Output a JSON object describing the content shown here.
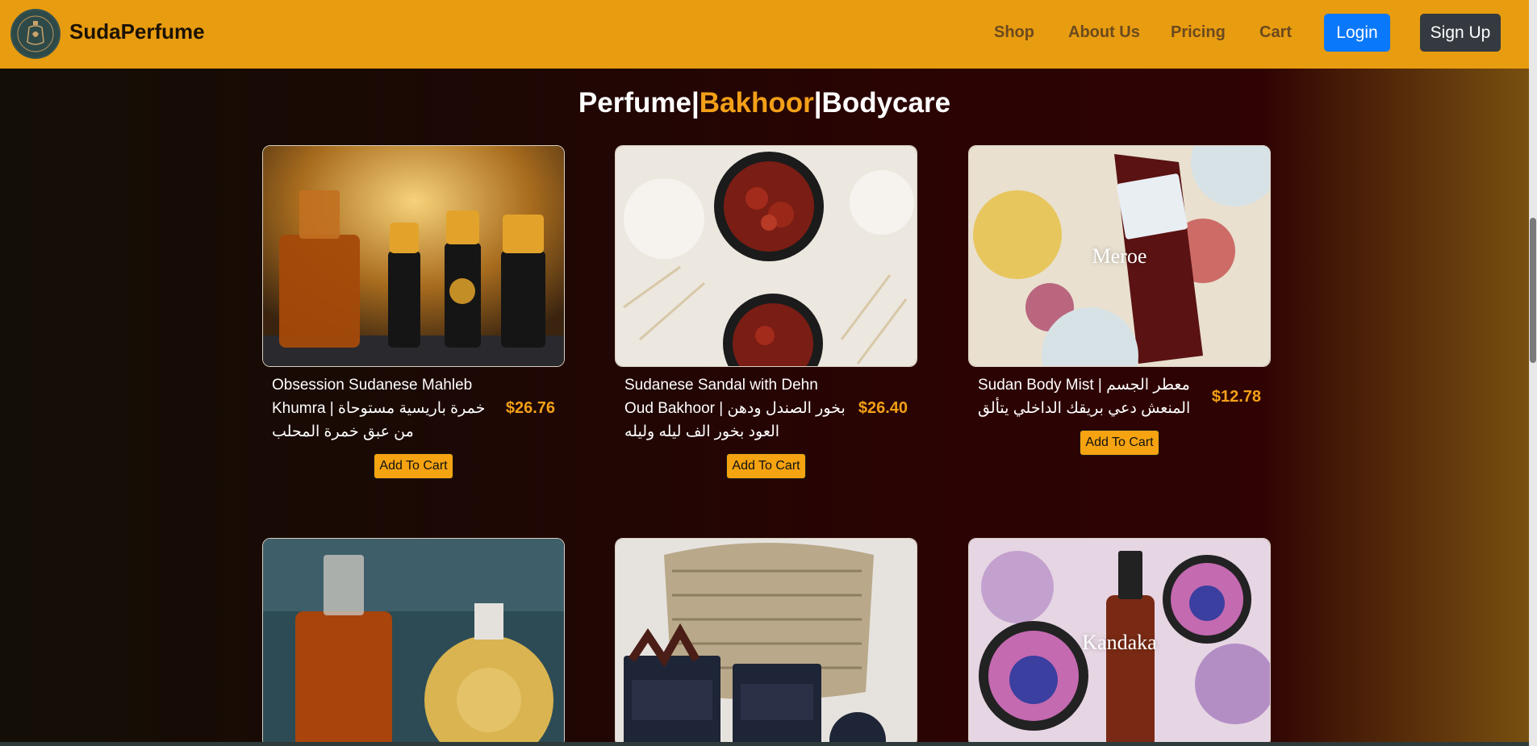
{
  "brand": {
    "name": "SudaPerfume",
    "logo_icon": "perfume-logo-icon"
  },
  "nav": {
    "links": [
      {
        "label": "Shop"
      },
      {
        "label": "About Us"
      },
      {
        "label": "Pricing"
      },
      {
        "label": "Cart"
      }
    ],
    "login_label": "Login",
    "signup_label": "Sign Up"
  },
  "section_title": {
    "part1": "Perfume",
    "sep1": "|",
    "part2": "Bakhoor",
    "sep2": "|",
    "part3": "Bodycare"
  },
  "colors": {
    "navbar": "#e89c10",
    "accent": "#f3a018",
    "login": "#0a78fa",
    "signup": "#343a40"
  },
  "products": [
    {
      "name": "Obsession Sudanese Mahleb Khumra | خمرة باريسية مستوحاة من عبق خمرة المحلب",
      "price": "$26.76",
      "cart_label": "Add To Cart",
      "image_label": ""
    },
    {
      "name": "Sudanese Sandal with Dehn Oud Bakhoor | بخور الصندل ودهن العود بخور الف ليله وليله",
      "price": "$26.40",
      "cart_label": "Add To Cart",
      "image_label": ""
    },
    {
      "name": "Sudan Body Mist | معطر الجسم المنعش دعي بريقك الداخلي يتألق",
      "price": "$12.78",
      "cart_label": "Add To Cart",
      "image_label": "Meroe"
    },
    {
      "name": "",
      "price": "",
      "cart_label": "",
      "image_label": ""
    },
    {
      "name": "",
      "price": "",
      "cart_label": "",
      "image_label": ""
    },
    {
      "name": "",
      "price": "",
      "cart_label": "",
      "image_label": "Kandaka"
    }
  ]
}
